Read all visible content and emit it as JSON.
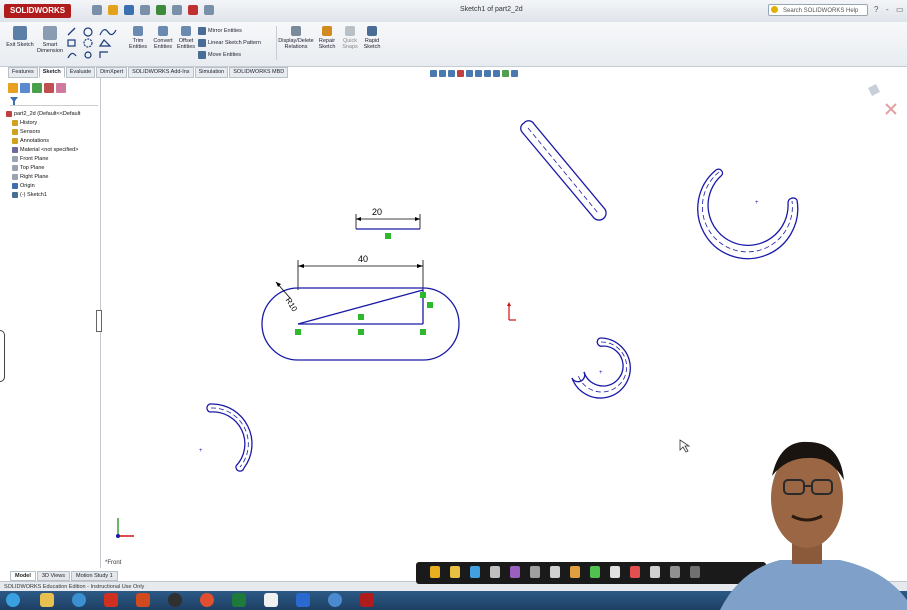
{
  "app": {
    "logo": "SOLIDWORKS",
    "doc_title": "Sketch1 of part2_2d",
    "search_placeholder": "Search SOLIDWORKS Help",
    "window_controls": [
      "?",
      "-",
      "▭"
    ]
  },
  "command_manager": {
    "exit_sketch": "Exit Sketch",
    "smart_dimension": "Smart Dimension",
    "trim_entities": "Trim Entities",
    "convert_entities": "Convert Entities",
    "offset_entities": "Offset Entities",
    "mirror_entities": "Mirror Entities",
    "linear_sketch_pattern": "Linear Sketch Pattern",
    "move_entities": "Move Entities",
    "display_delete_relations": "Display/Delete Relations",
    "repair_sketch": "Repair Sketch",
    "quick_snaps": "Quick Snaps",
    "rapid_sketch": "Rapid Sketch"
  },
  "tabs": [
    "Features",
    "Sketch",
    "Evaluate",
    "DimXpert",
    "SOLIDWORKS Add-Ins",
    "Simulation",
    "SOLIDWORKS MBD"
  ],
  "active_tab": "Sketch",
  "tree": [
    {
      "label": "part2_2d  (Default<<Default",
      "icon": "part-icon"
    },
    {
      "label": "History",
      "icon": "history-icon"
    },
    {
      "label": "Sensors",
      "icon": "sensor-icon"
    },
    {
      "label": "Annotations",
      "icon": "annotation-icon"
    },
    {
      "label": "Material <not specified>",
      "icon": "material-icon"
    },
    {
      "label": "Front Plane",
      "icon": "plane-icon"
    },
    {
      "label": "Top Plane",
      "icon": "plane-icon"
    },
    {
      "label": "Right Plane",
      "icon": "plane-icon"
    },
    {
      "label": "Origin",
      "icon": "origin-icon"
    },
    {
      "label": "(-) Sketch1",
      "icon": "sketch-icon"
    }
  ],
  "sketch": {
    "dim_top": "20",
    "dim_length": "40",
    "dim_radius": "R10",
    "view_label": "*Front"
  },
  "bottom_tabs": [
    "Model",
    "3D Views",
    "Motion Study 1"
  ],
  "status_text": "SOLIDWORKS Education Edition - Instructional Use Only",
  "colors": {
    "sketch_line": "#1a1aa8",
    "dimension": "#000000",
    "relation": "#2eb82e",
    "origin": "#d01010"
  }
}
